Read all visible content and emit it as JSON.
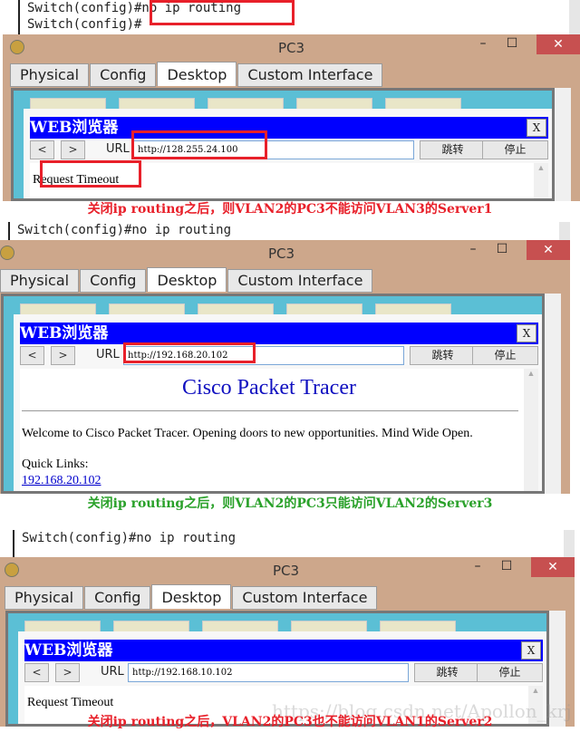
{
  "colors": {
    "caption_red": "#e8202a",
    "caption_green": "#2aa12a",
    "browser_title": "#0000ff",
    "desktop_bg": "#5bbfd5",
    "window_frame": "#cda78b"
  },
  "panels": [
    {
      "terminal_lines": [
        "Switch(config)#no ip routing",
        "Switch(config)#"
      ],
      "window_title": "PC3",
      "tabs": [
        "Physical",
        "Config",
        "Desktop",
        "Custom Interface"
      ],
      "browser_title": "WEB浏览器",
      "close_label": "X",
      "back": "<",
      "forward": ">",
      "url_label": "URL",
      "url": "http://128.255.24.100",
      "go": "跳转",
      "stop": "停止",
      "page_text": "Request Timeout",
      "caption": "关闭ip routing之后，则VLAN2的PC3不能访问VLAN3的Server1"
    },
    {
      "terminal_lines": [
        "Switch(config)#no ip routing"
      ],
      "window_title": "PC3",
      "tabs": [
        "Physical",
        "Config",
        "Desktop",
        "Custom Interface"
      ],
      "browser_title": "WEB浏览器",
      "close_label": "X",
      "back": "<",
      "forward": ">",
      "url_label": "URL",
      "url": "http://192.168.20.102",
      "go": "跳转",
      "stop": "停止",
      "page_heading": "Cisco Packet Tracer",
      "page_text": "Welcome to Cisco Packet Tracer. Opening doors to new opportunities. Mind Wide Open.",
      "quick_links_label": "Quick Links:",
      "quick_link": "192.168.20.102",
      "caption": "关闭ip routing之后，则VLAN2的PC3只能访问VLAN2的Server3"
    },
    {
      "terminal_lines": [
        "Switch(config)#no ip routing"
      ],
      "window_title": "PC3",
      "tabs": [
        "Physical",
        "Config",
        "Desktop",
        "Custom Interface"
      ],
      "browser_title": "WEB浏览器",
      "close_label": "X",
      "back": "<",
      "forward": ">",
      "url_label": "URL",
      "url": "http://192.168.10.102",
      "go": "跳转",
      "stop": "停止",
      "page_text": "Request Timeout",
      "caption": "关闭ip routing之后，VLAN2的PC3也不能访问VLAN1的Server2",
      "watermark": "https://blog.csdn.net/Apollon_krj"
    }
  ]
}
